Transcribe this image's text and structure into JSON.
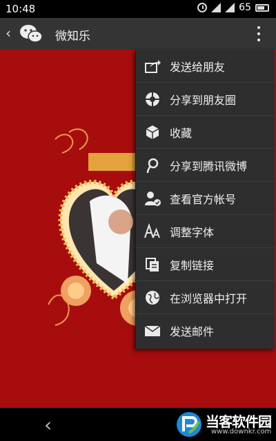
{
  "status": {
    "time": "10:48",
    "battery": "65"
  },
  "header": {
    "title": "微知乐"
  },
  "menu": {
    "items": [
      {
        "icon": "share-forward-icon",
        "label": "发送给朋友"
      },
      {
        "icon": "moments-icon",
        "label": "分享到朋友圈"
      },
      {
        "icon": "favorite-box-icon",
        "label": "收藏"
      },
      {
        "icon": "tencent-weibo-icon",
        "label": "分享到腾讯微博"
      },
      {
        "icon": "official-account-icon",
        "label": "查看官方帐号"
      },
      {
        "icon": "font-size-icon",
        "label": "调整字体"
      },
      {
        "icon": "copy-link-icon",
        "label": "复制链接"
      },
      {
        "icon": "globe-icon",
        "label": "在浏览器中打开"
      },
      {
        "icon": "mail-icon",
        "label": "发送邮件"
      }
    ]
  },
  "watermark": {
    "name": "当客软件园",
    "url": "www.downkr.com"
  },
  "colors": {
    "page_background": "#a80d0e",
    "menu_background": "#2e2e2e",
    "action_bar": "#343434"
  }
}
